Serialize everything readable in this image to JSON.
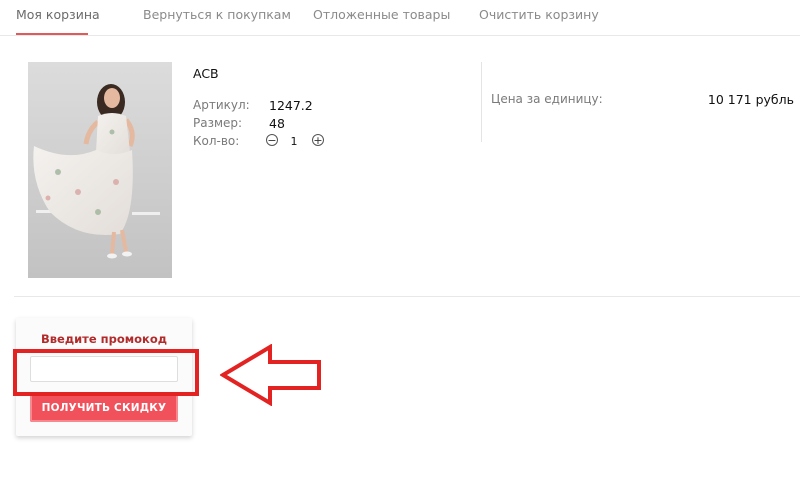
{
  "tabs": [
    {
      "label": "Моя корзина",
      "active": true
    },
    {
      "label": "Вернуться к покупкам",
      "active": false
    },
    {
      "label": "Отложенные товары",
      "active": false
    },
    {
      "label": "Очистить корзину",
      "active": false
    }
  ],
  "item": {
    "name": "ACB",
    "details": {
      "article_label": "Артикул:",
      "article_value": "1247.2",
      "size_label": "Размер:",
      "size_value": "48",
      "qty_label": "Кол-во:",
      "qty_value": "1",
      "minus_symbol": "−",
      "plus_symbol": "+"
    },
    "price_label": "Цена за единицу:",
    "price_value": "10 171 рубль"
  },
  "promo": {
    "title": "Введите промокод",
    "input_value": "",
    "input_placeholder": "",
    "button_label": "ПОЛУЧИТЬ СКИДКУ"
  },
  "colors": {
    "accent": "#e15a5a",
    "button": "#f0515b",
    "promo_title": "#b22a2a",
    "annotation": "#e32222"
  },
  "icons": {
    "minus": "minus-icon",
    "plus": "plus-icon",
    "annotation_arrow": "arrow-left-icon"
  }
}
